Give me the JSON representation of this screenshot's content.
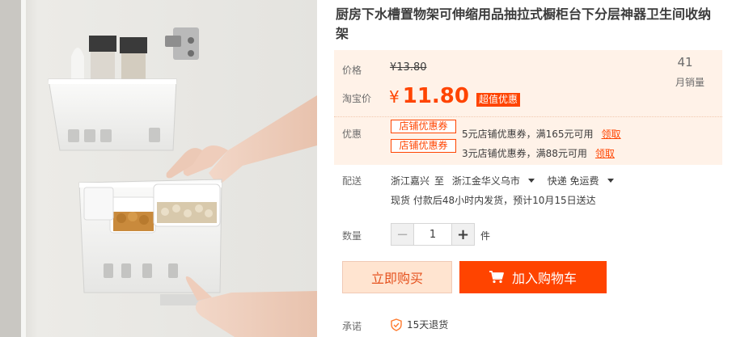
{
  "product": {
    "title": "厨房下水槽置物架可伸缩用品抽拉式橱柜台下分层神器卫生间收纳架"
  },
  "price": {
    "label": "价格",
    "original": "¥13.80",
    "promo_label": "淘宝价",
    "currency": "¥",
    "promo_amount": "11.80",
    "badge": "超值优惠"
  },
  "sales": {
    "count": "41",
    "label": "月销量"
  },
  "coupons": {
    "label": "优惠",
    "items": [
      {
        "tag": "店铺优惠券",
        "text": "5元店铺优惠券，满165元可用",
        "action": "领取"
      },
      {
        "tag": "店铺优惠券",
        "text": "3元店铺优惠券，满88元可用",
        "action": "领取"
      }
    ]
  },
  "delivery": {
    "label": "配送",
    "from": "浙江嘉兴",
    "to_prefix": "至",
    "to": "浙江金华义乌市",
    "shipping": "快递 免运费",
    "eta": "现货 付款后48小时内发货，预计10月15日送达"
  },
  "quantity": {
    "label": "数量",
    "value": "1",
    "minus": "−",
    "plus": "+",
    "unit": "件"
  },
  "actions": {
    "buy_now": "立即购买",
    "add_to_cart": "加入购物车"
  },
  "promise": {
    "label": "承诺",
    "item": "15天退货"
  },
  "colors": {
    "accent": "#ff4400",
    "panel_bg": "#fff2e8",
    "buy_now_bg": "#ffe4d0"
  },
  "icons": {
    "cart": "cart-icon",
    "shield": "shield-icon",
    "dropdown": "chevron-down-icon"
  }
}
